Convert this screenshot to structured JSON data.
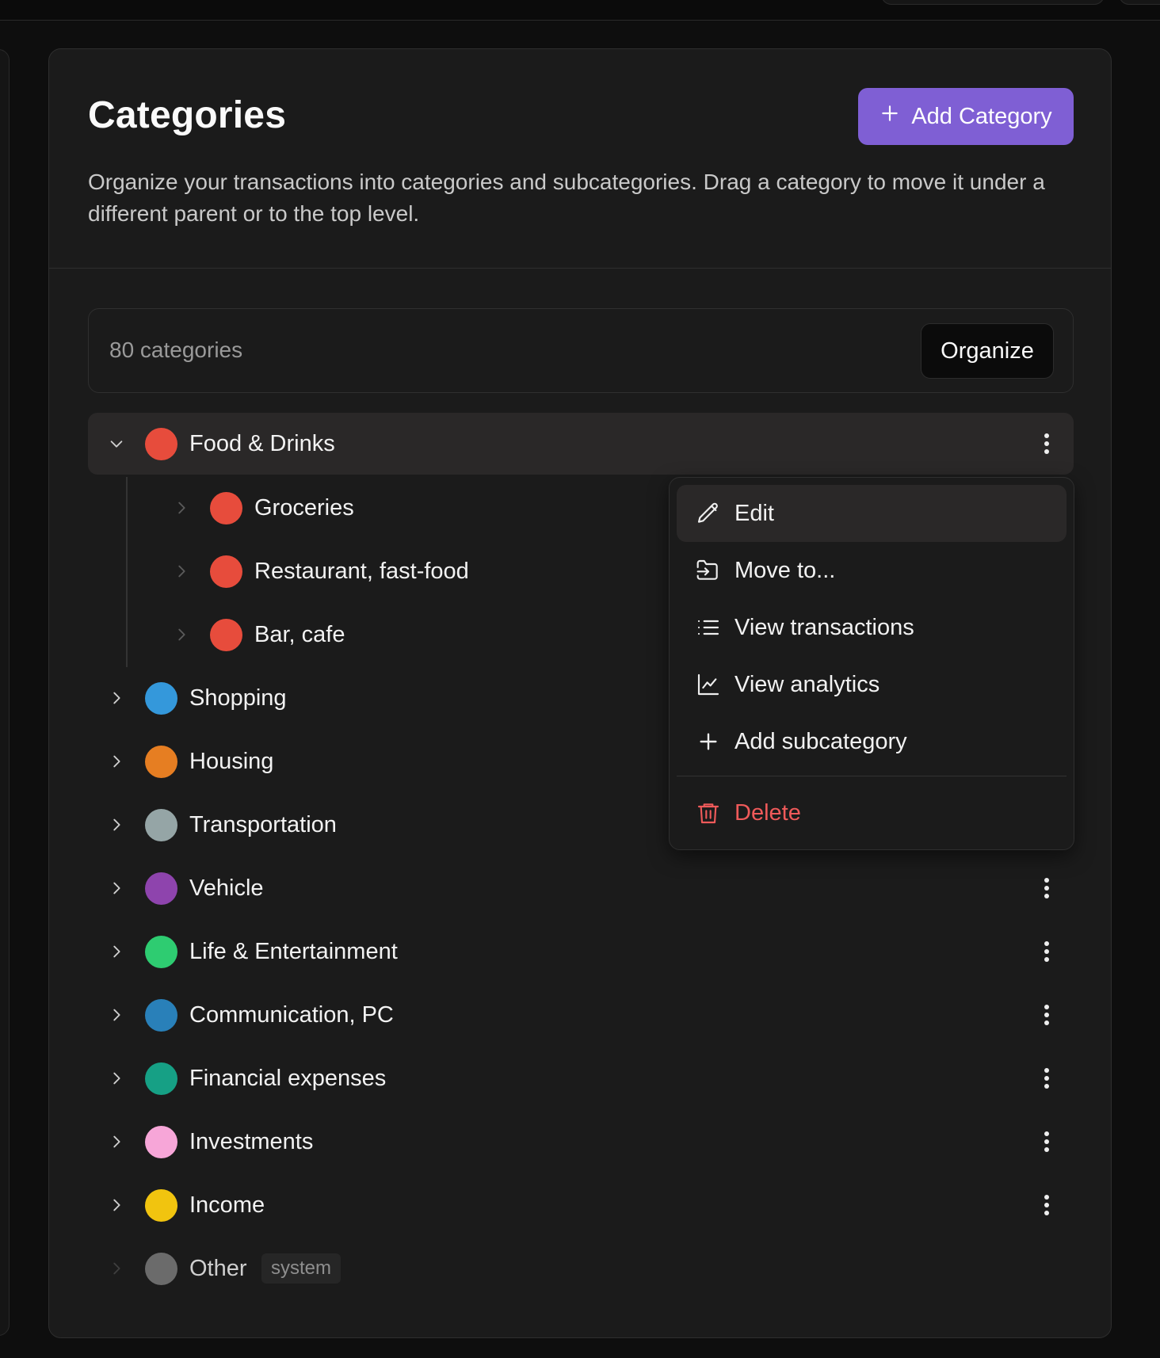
{
  "header": {
    "title": "Categories",
    "add_button_label": "Add Category",
    "description": "Organize your transactions into categories and subcategories. Drag a category to move it under a different parent or to the top level."
  },
  "toolbar": {
    "count_label": "80 categories",
    "organize_label": "Organize"
  },
  "categories": [
    {
      "label": "Food & Drinks",
      "color": "#e74c3c",
      "expanded": true
    },
    {
      "label": "Groceries",
      "color": "#e74c3c"
    },
    {
      "label": "Restaurant, fast-food",
      "color": "#e74c3c"
    },
    {
      "label": "Bar, cafe",
      "color": "#e74c3c"
    },
    {
      "label": "Shopping",
      "color": "#3498db"
    },
    {
      "label": "Housing",
      "color": "#e67e22"
    },
    {
      "label": "Transportation",
      "color": "#95a5a6"
    },
    {
      "label": "Vehicle",
      "color": "#8e44ad"
    },
    {
      "label": "Life & Entertainment",
      "color": "#2ecc71"
    },
    {
      "label": "Communication, PC",
      "color": "#2980b9"
    },
    {
      "label": "Financial expenses",
      "color": "#16a085"
    },
    {
      "label": "Investments",
      "color": "#f7a6d8"
    },
    {
      "label": "Income",
      "color": "#f1c40f"
    },
    {
      "label": "Other",
      "color": "#6b6b6b",
      "badge": "system"
    }
  ],
  "context_menu": {
    "edit": "Edit",
    "move": "Move to...",
    "view_transactions": "View transactions",
    "view_analytics": "View analytics",
    "add_subcategory": "Add subcategory",
    "delete": "Delete"
  }
}
